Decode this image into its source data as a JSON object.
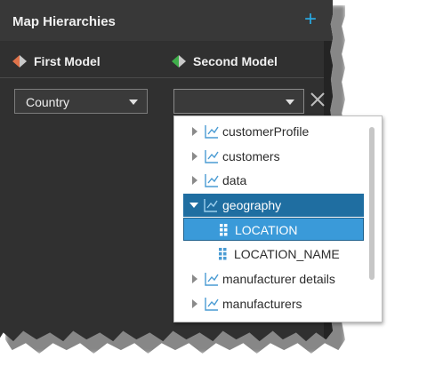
{
  "panel": {
    "title": "Map Hierarchies",
    "add_label": "+"
  },
  "models": {
    "first": "First Model",
    "second": "Second Model"
  },
  "first_select": {
    "value": "Country"
  },
  "second_select": {
    "value": ""
  },
  "dropdown": {
    "items": [
      {
        "label": "customerProfile",
        "expanded": false
      },
      {
        "label": "customers",
        "expanded": false
      },
      {
        "label": "data",
        "expanded": false
      },
      {
        "label": "geography",
        "expanded": true
      },
      {
        "label": "LOCATION",
        "level": true,
        "selected": true
      },
      {
        "label": "LOCATION_NAME",
        "level": true
      },
      {
        "label": "manufacturer details",
        "expanded": false
      },
      {
        "label": "manufacturers",
        "expanded": false
      }
    ]
  },
  "colors": {
    "accent": "#29a8e0",
    "selected_parent": "#1f6ea1",
    "selected_child": "#3a9ad9",
    "model_orange": "#e0734a",
    "model_green": "#3fae4a"
  }
}
